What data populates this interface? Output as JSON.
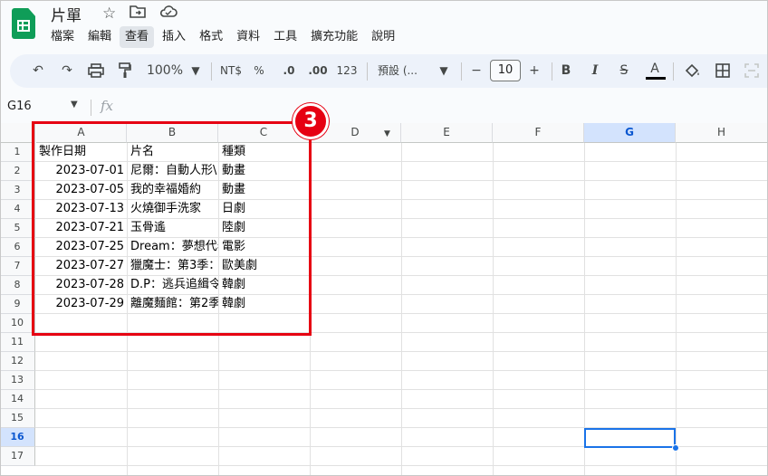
{
  "header": {
    "title": "片單",
    "icons": [
      "star-icon",
      "move-folder-icon",
      "cloud-status-icon"
    ]
  },
  "menu": [
    "檔案",
    "編輯",
    "查看",
    "插入",
    "格式",
    "資料",
    "工具",
    "擴充功能",
    "說明"
  ],
  "menu_active": "查看",
  "toolbar": {
    "zoom": "100%",
    "currency": "NT$",
    "percent": "%",
    "dec_decrease": ".0",
    "dec_increase": ".00",
    "number_format": "123",
    "font": "預設 (...",
    "font_size": "10",
    "minus": "−",
    "plus": "+",
    "bold": "B",
    "italic": "I",
    "strike": "S",
    "text_color": "A"
  },
  "formula_bar": {
    "cell_ref": "G16",
    "fx": "fx"
  },
  "columns": [
    "A",
    "B",
    "C",
    "D",
    "E",
    "F",
    "G",
    "H"
  ],
  "selected_column": "G",
  "rows": [
    "1",
    "2",
    "3",
    "4",
    "5",
    "6",
    "7",
    "8",
    "9",
    "10",
    "11",
    "12",
    "13",
    "14",
    "15",
    "16",
    "17"
  ],
  "selected_row": "16",
  "table": {
    "headers": [
      "製作日期",
      "片名",
      "種類"
    ],
    "data": [
      [
        "2023-07-01",
        "尼爾：自動人形\\",
        "動畫"
      ],
      [
        "2023-07-05",
        "我的幸福婚約",
        "動畫"
      ],
      [
        "2023-07-13",
        "火燒御手洗家",
        "日劇"
      ],
      [
        "2023-07-21",
        "玉骨遙",
        "陸劇"
      ],
      [
        "2023-07-25",
        "Dream：夢想代表",
        "電影"
      ],
      [
        "2023-07-27",
        "獵魔士：第3季：",
        "歐美劇"
      ],
      [
        "2023-07-28",
        "D.P：逃兵追緝令",
        "韓劇"
      ],
      [
        "2023-07-29",
        "離魔麵館：第2季",
        "韓劇"
      ]
    ]
  },
  "annotation": {
    "step": "3",
    "color": "#e60012"
  },
  "colors": {
    "accent": "#1a73e8",
    "sheets_green": "#0f9d58",
    "selected_header": "#d3e3fd"
  }
}
